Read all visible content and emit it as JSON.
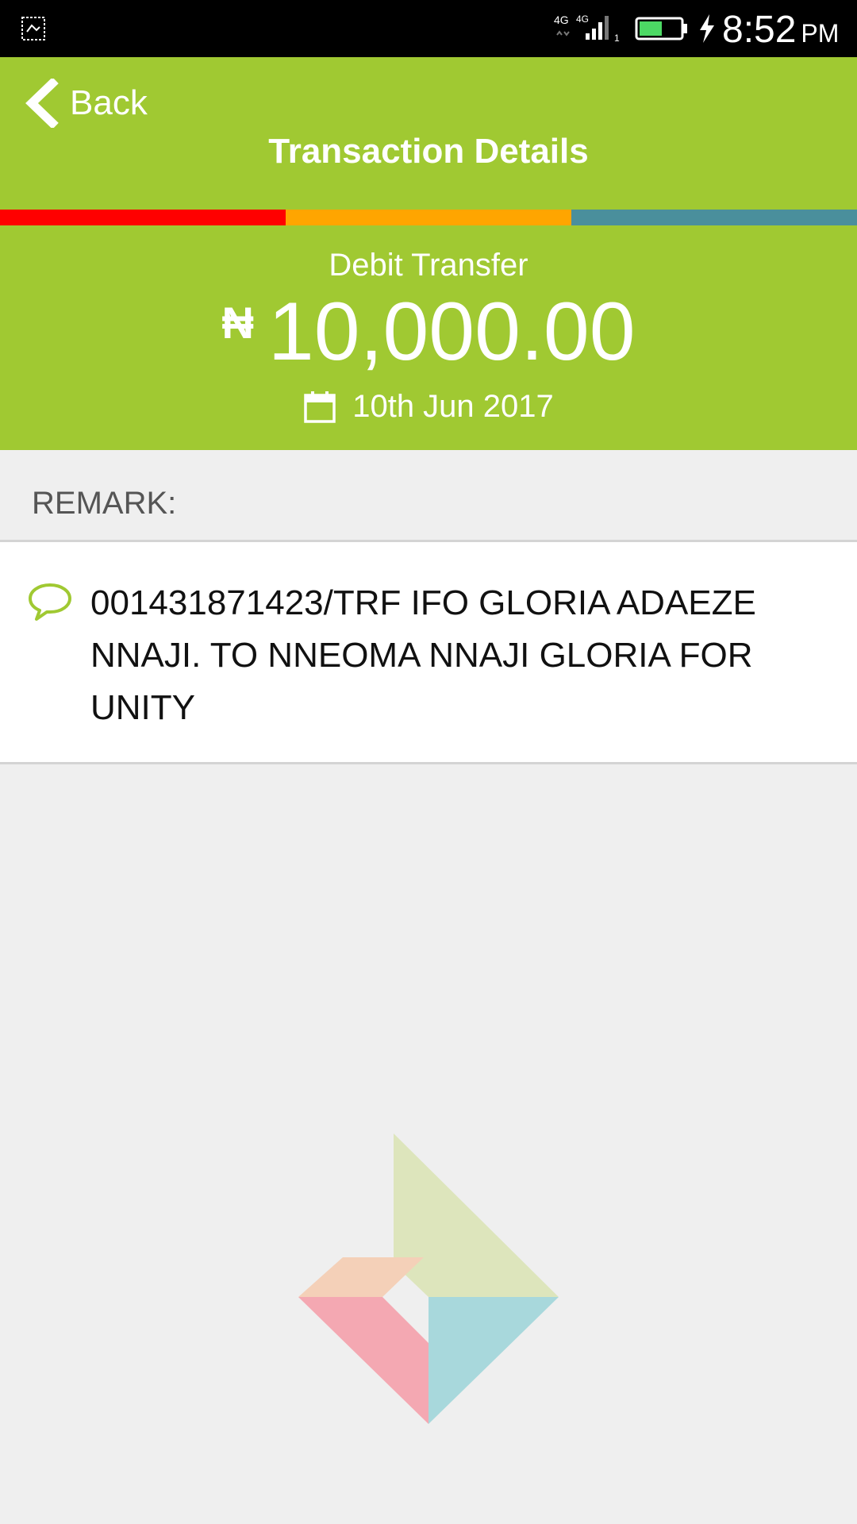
{
  "status_bar": {
    "network_label": "4G 4G",
    "sim_slot": "1",
    "time": "8:52",
    "ampm": "PM"
  },
  "header": {
    "back_label": "Back",
    "title": "Transaction Details"
  },
  "stripe_colors": [
    "#ff0000",
    "#ffa500",
    "#4a8f9c"
  ],
  "summary": {
    "type": "Debit Transfer",
    "currency": "₦",
    "amount": "10,000.00",
    "date": "10th Jun 2017"
  },
  "remark": {
    "label": "REMARK:",
    "text": "001431871423/TRF IFO GLORIA ADAEZE NNAJI. TO NNEOMA NNAJI GLORIA FOR UNITY"
  },
  "colors": {
    "brand_green": "#a0c932",
    "background": "#efefef"
  },
  "icons": {
    "status_left": "screenshot-icon",
    "back": "chevron-left-icon",
    "calendar": "calendar-icon",
    "remark": "speech-bubble-icon",
    "logo": "diamond-logo"
  }
}
